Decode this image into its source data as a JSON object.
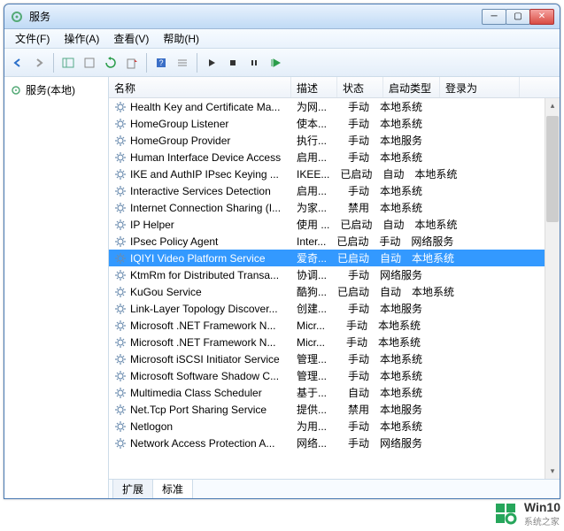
{
  "window": {
    "title": "服务"
  },
  "menu": {
    "file": "文件(F)",
    "action": "操作(A)",
    "view": "查看(V)",
    "help": "帮助(H)"
  },
  "tree": {
    "root": "服务(本地)"
  },
  "columns": {
    "name": "名称",
    "description": "描述",
    "status": "状态",
    "startup": "启动类型",
    "logon": "登录为"
  },
  "tabs": {
    "extended": "扩展",
    "standard": "标准"
  },
  "services": [
    {
      "name": "Health Key and Certificate Ma...",
      "desc": "为网...",
      "status": "",
      "startup": "手动",
      "logon": "本地系统"
    },
    {
      "name": "HomeGroup Listener",
      "desc": "使本...",
      "status": "",
      "startup": "手动",
      "logon": "本地系统"
    },
    {
      "name": "HomeGroup Provider",
      "desc": "执行...",
      "status": "",
      "startup": "手动",
      "logon": "本地服务"
    },
    {
      "name": "Human Interface Device Access",
      "desc": "启用...",
      "status": "",
      "startup": "手动",
      "logon": "本地系统"
    },
    {
      "name": "IKE and AuthIP IPsec Keying ...",
      "desc": "IKEE...",
      "status": "已启动",
      "startup": "自动",
      "logon": "本地系统"
    },
    {
      "name": "Interactive Services Detection",
      "desc": "启用...",
      "status": "",
      "startup": "手动",
      "logon": "本地系统"
    },
    {
      "name": "Internet Connection Sharing (I...",
      "desc": "为家...",
      "status": "",
      "startup": "禁用",
      "logon": "本地系统"
    },
    {
      "name": "IP Helper",
      "desc": "使用 ...",
      "status": "已启动",
      "startup": "自动",
      "logon": "本地系统"
    },
    {
      "name": "IPsec Policy Agent",
      "desc": "Inter...",
      "status": "已启动",
      "startup": "手动",
      "logon": "网络服务"
    },
    {
      "name": "IQIYI Video Platform Service",
      "desc": "爱奇...",
      "status": "已启动",
      "startup": "自动",
      "logon": "本地系统",
      "selected": true
    },
    {
      "name": "KtmRm for Distributed Transa...",
      "desc": "协调...",
      "status": "",
      "startup": "手动",
      "logon": "网络服务"
    },
    {
      "name": "KuGou Service",
      "desc": "酷狗...",
      "status": "已启动",
      "startup": "自动",
      "logon": "本地系统"
    },
    {
      "name": "Link-Layer Topology Discover...",
      "desc": "创建...",
      "status": "",
      "startup": "手动",
      "logon": "本地服务"
    },
    {
      "name": "Microsoft .NET Framework N...",
      "desc": "Micr...",
      "status": "",
      "startup": "手动",
      "logon": "本地系统"
    },
    {
      "name": "Microsoft .NET Framework N...",
      "desc": "Micr...",
      "status": "",
      "startup": "手动",
      "logon": "本地系统"
    },
    {
      "name": "Microsoft iSCSI Initiator Service",
      "desc": "管理...",
      "status": "",
      "startup": "手动",
      "logon": "本地系统"
    },
    {
      "name": "Microsoft Software Shadow C...",
      "desc": "管理...",
      "status": "",
      "startup": "手动",
      "logon": "本地系统"
    },
    {
      "name": "Multimedia Class Scheduler",
      "desc": "基于...",
      "status": "",
      "startup": "自动",
      "logon": "本地系统"
    },
    {
      "name": "Net.Tcp Port Sharing Service",
      "desc": "提供...",
      "status": "",
      "startup": "禁用",
      "logon": "本地服务"
    },
    {
      "name": "Netlogon",
      "desc": "为用...",
      "status": "",
      "startup": "手动",
      "logon": "本地系统"
    },
    {
      "name": "Network Access Protection A...",
      "desc": "网络...",
      "status": "",
      "startup": "手动",
      "logon": "网络服务"
    }
  ],
  "watermark": {
    "line1": "Win10",
    "line2": "系统之家"
  }
}
